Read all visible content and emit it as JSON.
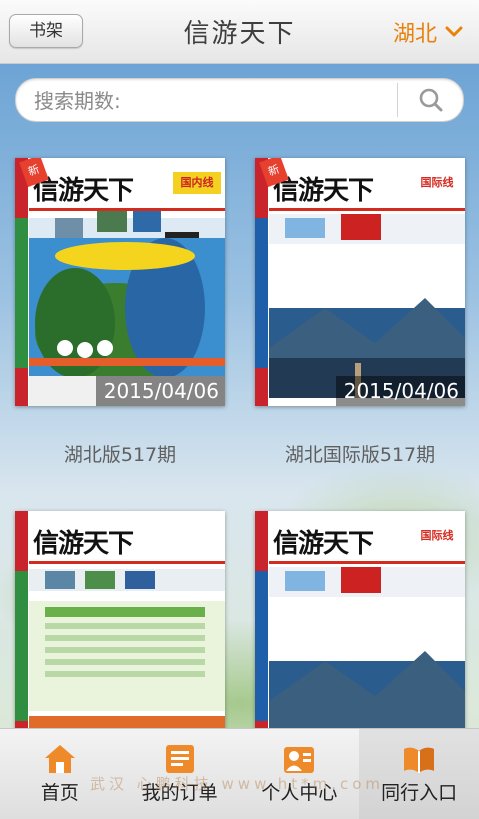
{
  "header": {
    "shelf_label": "书架",
    "title": "信游天下",
    "region_label": "湖北",
    "accent_color": "#e8820c"
  },
  "search": {
    "placeholder": "搜索期数:",
    "value": ""
  },
  "magazines": [
    {
      "brand": "信游天下",
      "tag": "国内线",
      "date": "2015/04/06",
      "caption": "湖北版517期"
    },
    {
      "brand": "信游天下",
      "tag": "国际线",
      "date": "2015/04/06",
      "caption": "湖北国际版517期"
    },
    {
      "brand": "信游天下",
      "tag": "",
      "date": "",
      "caption": ""
    },
    {
      "brand": "信游天下",
      "tag": "国际线",
      "date": "",
      "caption": ""
    }
  ],
  "tabs": [
    {
      "label": "首页",
      "icon": "home-icon"
    },
    {
      "label": "我的订单",
      "icon": "orders-icon"
    },
    {
      "label": "个人中心",
      "icon": "profile-icon"
    },
    {
      "label": "同行入口",
      "icon": "book-icon"
    }
  ],
  "watermark": "武汉 心鹏科技 www.ht*m.com"
}
